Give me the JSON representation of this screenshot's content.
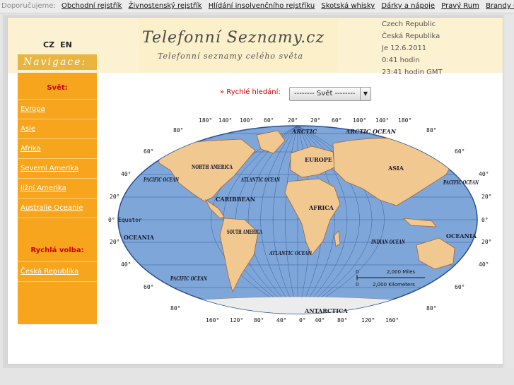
{
  "recommend": {
    "label": "Doporučujeme:",
    "links": [
      "Obchodní rejstřík",
      "Živnostenský rejstřík",
      "Hlídání insolvenčního rejstříku",
      "Skotská whisky",
      "Dárky a nápoje",
      "Pravý Rum",
      "Brandy Cognac"
    ]
  },
  "header": {
    "lang_cz": "CZ",
    "lang_en": "EN",
    "navigace": "Navigace:",
    "logo_title": "Telefonní Seznamy.cz",
    "logo_subtitle": "Telefonní seznamy celého světa",
    "info": [
      "Czech Republic",
      "Česká Republika",
      "Je 12.6.2011",
      "0:41 hodin",
      "23:41 hodin GMT"
    ]
  },
  "sidebar": {
    "world_heading": "Svět:",
    "world_links": [
      "Evropa",
      "Asie",
      "Afrika",
      "Severní Amerika",
      "Jižní Amerika",
      "Australie Oceanie"
    ],
    "quick_heading": "Rychlá volba:",
    "quick_links": [
      "Česká Republika"
    ]
  },
  "search": {
    "label": "» Rychlé hledání:",
    "selected": "-------- Svět --------"
  },
  "map": {
    "top_degrees": [
      "180°",
      "140°",
      "100°",
      "60°",
      "20°",
      "20°",
      "60°",
      "100°",
      "140°",
      "180°"
    ],
    "bottom_degrees": [
      "160°",
      "120°",
      "80°",
      "40°",
      "0°",
      "40°",
      "80°",
      "120°",
      "160°"
    ],
    "lat_left": [
      "80°",
      "60°",
      "40°",
      "20°",
      "0°",
      "20°",
      "40°",
      "60°",
      "80°"
    ],
    "lat_right": [
      "80°",
      "60°",
      "40°",
      "20°",
      "0°",
      "20°",
      "40°",
      "60°",
      "80°"
    ],
    "equator": "Equator",
    "continents": [
      "NORTH AMERICA",
      "SOUTH AMERICA",
      "EUROPE",
      "ASIA",
      "AFRICA",
      "ANTARCTICA"
    ],
    "oceans": [
      "PACIFIC OCEAN",
      "ATLANTIC OCEAN",
      "CARIBBEAN",
      "ARCTIC",
      "ARCTIC OCEAN",
      "PACIFIC OCEAN",
      "OCEANIA",
      "ATLANTIC OCEAN",
      "INDIAN OCEAN",
      "OCEANIA",
      "PACIFIC OCEAN"
    ],
    "scale": [
      "0",
      "2,000 Miles",
      "0",
      "2,000 Kilometers"
    ],
    "colors": {
      "ocean": "#7ea6d8",
      "land": "#f0c890",
      "ice": "#ececec",
      "grid": "#3a5fa0"
    }
  }
}
